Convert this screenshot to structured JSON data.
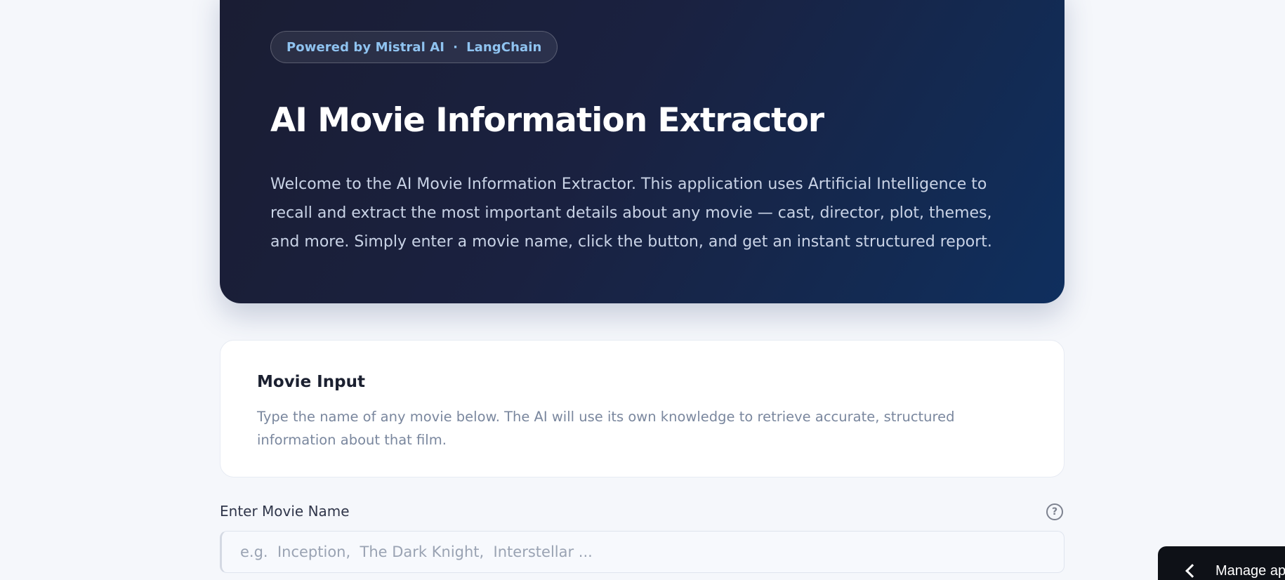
{
  "hero": {
    "badge_left": "Powered by Mistral AI",
    "badge_sep": "·",
    "badge_right": "LangChain",
    "title": "AI Movie Information Extractor",
    "description": "Welcome to the AI Movie Information Extractor. This application uses Artificial Intelligence to recall and extract the most important details about any movie — cast, director, plot, themes, and more. Simply enter a movie name, click the button, and get an instant structured report."
  },
  "input_card": {
    "title": "Movie Input",
    "description": "Type the name of any movie below. The AI will use its own knowledge to retrieve accurate, structured information about that film."
  },
  "movie_field": {
    "label": "Enter Movie Name",
    "help_glyph": "?",
    "placeholder": "e.g.  Inception,  The Dark Knight,  Interstellar ...",
    "value": ""
  },
  "manage_app": {
    "label": "Manage app"
  },
  "icons": {
    "help": "question-circle-icon",
    "chevron": "chevron-left-icon"
  },
  "colors": {
    "hero_bg_start": "#1a1d33",
    "hero_bg_end": "#0f2f5e",
    "badge_text": "#8fc3f0",
    "page_bg": "#f5f7fb"
  }
}
